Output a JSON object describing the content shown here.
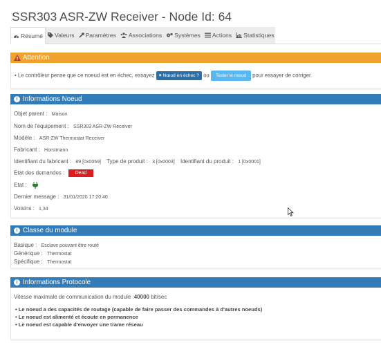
{
  "page": {
    "title": "SSR303 ASR-ZW Receiver - Node Id: 64"
  },
  "tabs": [
    {
      "label": "Résumé",
      "icon": "dashboard-icon",
      "active": true
    },
    {
      "label": "Valeurs",
      "icon": "tag-icon"
    },
    {
      "label": "Paramètres",
      "icon": "wrench-icon"
    },
    {
      "label": "Associations",
      "icon": "users-icon"
    },
    {
      "label": "Systèmes",
      "icon": "cogs-icon"
    },
    {
      "label": "Actions",
      "icon": "list-icon"
    },
    {
      "label": "Statistiques",
      "icon": "bar-chart-icon"
    }
  ],
  "attention": {
    "title": "Attention",
    "message_before": "Le contrôleur pense que ce noeud est en échec, essayez",
    "failed_button": "Nœud en échec ?",
    "middle": "ou",
    "test_button": "Tester le nœud",
    "message_after": "pour essayer de corriger."
  },
  "node_info": {
    "title": "Informations Noeud",
    "parent_label": "Objet parent :",
    "parent_value": "Maison",
    "equipment_label": "Nom de l'équipement :",
    "equipment_value": "SSR303 ASR-ZW Receiver",
    "model_label": "Modèle :",
    "model_value": "ASR-ZW Thermostat Receiver",
    "manufacturer_label": "Fabricant :",
    "manufacturer_value": "Horstmann",
    "manufacturer_id_label": "Identifiant du fabricant :",
    "manufacturer_id_value": "89 [0x0059]",
    "product_type_label": "Type de produit :",
    "product_type_value": "3 [0x0003]",
    "product_id_label": "Identifiant du produit :",
    "product_id_value": "1 [0x0001]",
    "requests_label": "Etat des demandes :",
    "requests_value": "Dead",
    "state_label": "Etat :",
    "state_icon": "plug-icon",
    "last_message_label": "Dernier message :",
    "last_message_value": "31/01/2020 17:20:40",
    "neighbors_label": "Voisins :",
    "neighbors_value": "1,34"
  },
  "module_class": {
    "title": "Classe du module",
    "basic_label": "Basique :",
    "basic_value": "Esclave pouvant être routé",
    "generic_label": "Générique :",
    "generic_value": "Thermostat",
    "specific_label": "Spécifique :",
    "specific_value": "Thermostat"
  },
  "protocol": {
    "title": "Informations Protocole",
    "speed_prefix": "Vitesse maximale de communication du module :",
    "speed_value": "40000",
    "speed_unit": "bit/sec",
    "features": [
      "Le noeud a des capacités de routage (capable de faire passer des commandes à d'autres noeuds)",
      "Le noeud est alimenté et écoute en permanence",
      "Le noeud est capable d'envoyer une trame réseau"
    ]
  },
  "colors": {
    "attention": "#f0a22e",
    "panel_header": "#347cb8",
    "dead_badge": "#d81e1e",
    "test_button": "#5bb7f0"
  }
}
